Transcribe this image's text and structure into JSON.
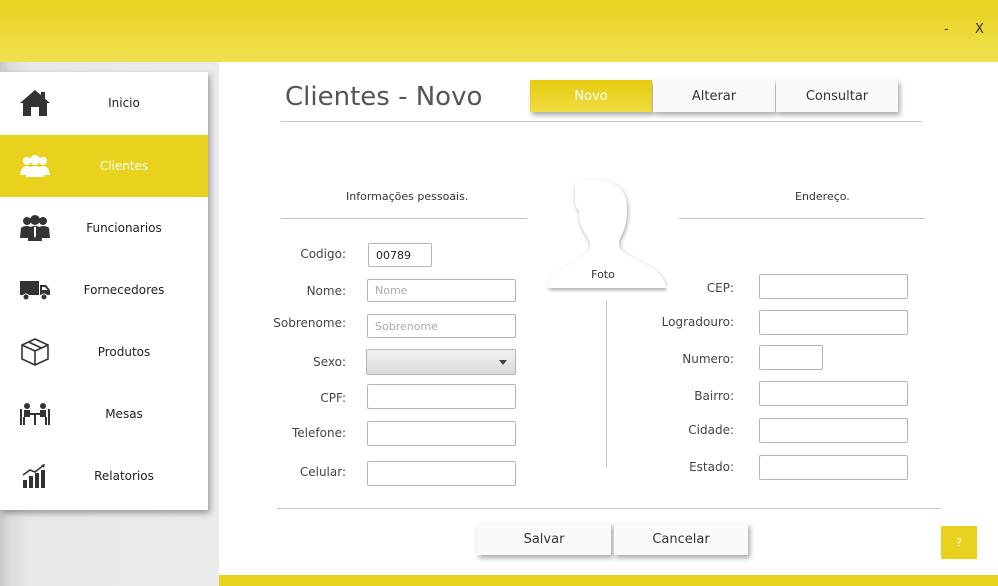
{
  "window": {
    "minimize_label": "-",
    "close_label": "X"
  },
  "colors": {
    "accent": "#e9d21e",
    "sidebar_bg": "#ffffff",
    "text": "#333333"
  },
  "sidebar": {
    "items": [
      {
        "label": "Inicio",
        "icon": "home-icon",
        "active": false
      },
      {
        "label": "Clientes",
        "icon": "users-icon",
        "active": true
      },
      {
        "label": "Funcionarios",
        "icon": "employees-icon",
        "active": false
      },
      {
        "label": "Fornecedores",
        "icon": "truck-icon",
        "active": false
      },
      {
        "label": "Produtos",
        "icon": "box-icon",
        "active": false
      },
      {
        "label": "Mesas",
        "icon": "tables-icon",
        "active": false
      },
      {
        "label": "Relatorios",
        "icon": "chart-icon",
        "active": false
      }
    ]
  },
  "header": {
    "title": "Clientes - Novo",
    "tabs": [
      {
        "label": "Novo",
        "active": true
      },
      {
        "label": "Alterar",
        "active": false
      },
      {
        "label": "Consultar",
        "active": false
      }
    ]
  },
  "personal": {
    "title": "Informações pessoais.",
    "codigo_label": "Codigo:",
    "codigo_value": "00789",
    "nome_label": "Nome:",
    "nome_placeholder": "Nome",
    "sobrenome_label": "Sobrenome:",
    "sobrenome_placeholder": "Sobrenome",
    "sexo_label": "Sexo:",
    "sexo_value": "",
    "cpf_label": "CPF:",
    "telefone_label": "Telefone:",
    "celular_label": "Celular:"
  },
  "photo": {
    "label": "Foto",
    "icon": "person-silhouette-icon"
  },
  "address": {
    "title": "Endereço.",
    "cep_label": "CEP:",
    "logradouro_label": "Logradouro:",
    "numero_label": "Numero:",
    "bairro_label": "Bairro:",
    "cidade_label": "Cidade:",
    "estado_label": "Estado:"
  },
  "actions": {
    "save_label": "Salvar",
    "cancel_label": "Cancelar",
    "help_label": "?"
  }
}
